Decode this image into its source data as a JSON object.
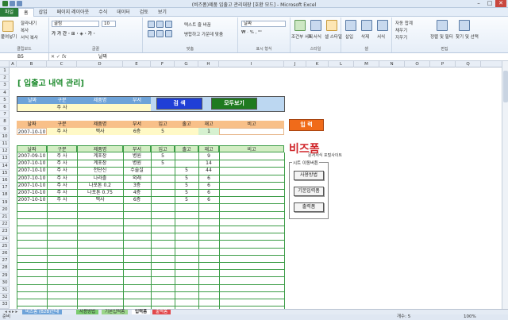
{
  "window": {
    "title": "(비즈폼)제품 입출고 관리대장 [호환 모드] - Microsoft Excel",
    "minimize": "–",
    "maximize": "□",
    "close": "✕"
  },
  "ribbon_tabs": [
    "파일",
    "홈",
    "삽입",
    "페이지 레이아웃",
    "수식",
    "데이터",
    "검토",
    "보기"
  ],
  "ribbon": {
    "clipboard": {
      "paste": "붙여넣기",
      "cut": "잘라내기",
      "copy": "복사",
      "format_painter": "서식 복사",
      "label": "클립보드"
    },
    "font": {
      "name": "굴림",
      "size": "10",
      "label": "글꼴"
    },
    "alignment": {
      "wrap": "텍스트 줄 바꿈",
      "merge": "병합하고 가운데 맞춤",
      "label": "맞춤"
    },
    "number": {
      "format": "날짜",
      "label": "표시 형식"
    },
    "styles": {
      "conditional": "조건부 서식",
      "table": "표 서식",
      "cell_styles": "셀 스타일",
      "label": "스타일"
    },
    "cells": {
      "insert": "삽입",
      "delete": "삭제",
      "format": "서식",
      "label": "셀"
    },
    "editing": {
      "autosum": "자동 합계",
      "fill": "채우기",
      "clear": "지우기",
      "sort": "정렬 및 필터",
      "find": "찾기 및 선택",
      "label": "편집"
    }
  },
  "formula_bar": {
    "name_box": "B5",
    "fx": "fx",
    "value": "날짜"
  },
  "columns": [
    "A",
    "B",
    "C",
    "D",
    "E",
    "F",
    "G",
    "H",
    "I",
    "J",
    "K",
    "L",
    "M",
    "N",
    "O",
    "P",
    "Q"
  ],
  "rows": [
    "1",
    "2",
    "3",
    "4",
    "5",
    "6",
    "7",
    "8",
    "9",
    "10",
    "11",
    "12",
    "13",
    "14",
    "15",
    "16",
    "17",
    "18",
    "19",
    "20",
    "21",
    "22",
    "23",
    "24",
    "25",
    "26",
    "27",
    "28",
    "29",
    "30",
    "31",
    "32",
    "33"
  ],
  "sheet": {
    "title": "[ 입출고 내역 관리]",
    "search_headers": [
      "날짜",
      "구분",
      "제품명",
      "부서"
    ],
    "search_row": [
      "",
      "주 사",
      "",
      ""
    ],
    "search_button": "검 색",
    "show_all_button": "모두보기",
    "input_headers": [
      "날짜",
      "구분",
      "제품명",
      "부서",
      "입고",
      "출고",
      "재고",
      "비고"
    ],
    "input_row": [
      "2007-10-10",
      "주 사",
      "멕사",
      "6층",
      "5",
      "",
      "1",
      ""
    ],
    "input_button": "입 력",
    "list_headers": [
      "날짜",
      "구분",
      "제품명",
      "부서",
      "입고",
      "출고",
      "재고",
      "비고"
    ],
    "list_rows": [
      [
        "2007-09-10",
        "주 사",
        "계포장",
        "병원",
        "5",
        "",
        "9",
        ""
      ],
      [
        "2007-10-10",
        "주 사",
        "계포장",
        "병원",
        "5",
        "",
        "14",
        ""
      ],
      [
        "2007-10-10",
        "주 사",
        "전단신",
        "수술실",
        "",
        "5",
        "44",
        ""
      ],
      [
        "2007-10-10",
        "주 사",
        "나라졸",
        "외래",
        "",
        "5",
        "6",
        ""
      ],
      [
        "2007-10-10",
        "주 사",
        "나포톤 0.2",
        "3층",
        "",
        "5",
        "6",
        ""
      ],
      [
        "2007-10-10",
        "주 사",
        "나포톤 0.75",
        "4층",
        "",
        "5",
        "6",
        ""
      ],
      [
        "2007-10-10",
        "주 사",
        "멕사",
        "6층",
        "",
        "5",
        "6",
        ""
      ]
    ],
    "logo": {
      "main": "비즈폼",
      "sub": "문서서식 포털사이트"
    },
    "sheet_move": {
      "title": "시트 이동버튼",
      "buttons": [
        "사용방법",
        "기본입력폼",
        "출력폼"
      ]
    }
  },
  "sheet_tabs": [
    "비즈폼 (B2B)안내",
    "사용방법",
    "기본입력폼",
    "입력폼",
    "출력폼"
  ],
  "status": {
    "ready": "준비",
    "count": "개수: 5",
    "zoom": "100%"
  },
  "colors": {
    "green": "#1c8a2c",
    "blue_btn": "#1f3fd6",
    "green_btn": "#1f7a1f",
    "orange_btn": "#f06b1a",
    "logo_red": "#d0262b"
  }
}
